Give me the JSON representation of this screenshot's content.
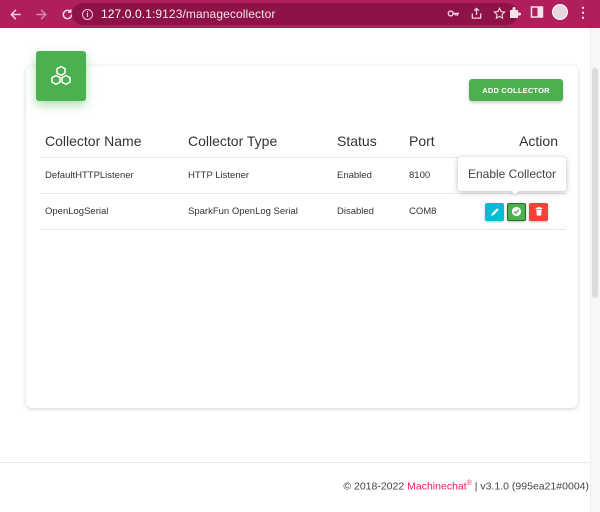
{
  "browser": {
    "url_host": "127.0.0.1",
    "url_path": ":9123/managecollector"
  },
  "page": {
    "add_button_label": "ADD COLLECTOR",
    "tooltip": "Enable Collector"
  },
  "table": {
    "headers": [
      "Collector Name",
      "Collector Type",
      "Status",
      "Port",
      "Action"
    ],
    "rows": [
      {
        "name": "DefaultHTTPListener",
        "type": "HTTP Listener",
        "status": "Enabled",
        "port": "8100"
      },
      {
        "name": "OpenLogSerial",
        "type": "SparkFun OpenLog Serial",
        "status": "Disabled",
        "port": "COM8"
      }
    ]
  },
  "footer": {
    "copyright": "© 2018-2022",
    "brand": "Machinechat",
    "reg": "®",
    "version": "| v3.1.0 (995ea21#0004)"
  },
  "icons": {
    "card": "cubes-icon",
    "edit": "pencil-icon",
    "enable": "check-circle-icon",
    "delete": "trash-icon"
  },
  "colors": {
    "browser_bar": "#ae1f5c",
    "primary_green": "#4caf50",
    "edit_cyan": "#00bcd4",
    "delete_red": "#f44336",
    "brand_pink": "#e91e63"
  }
}
